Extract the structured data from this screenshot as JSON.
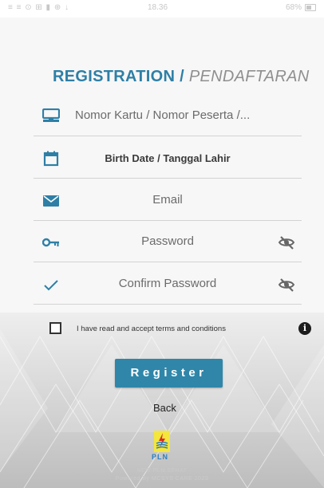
{
  "status_bar": {
    "left_icons": "≡ ≡ ⊙ ⊞ ▮ ⊕ ↓",
    "time": "18.36",
    "battery": "68%"
  },
  "title": {
    "main": "REGISTRATION",
    "slash": " / ",
    "sub": "PENDAFTARAN",
    "accent_color": "#2e7fa6"
  },
  "fields": {
    "card": {
      "placeholder": "Nomor Kartu / Nomor Peserta /...",
      "icon": "card-icon"
    },
    "birth_date": {
      "placeholder": "Birth Date / Tanggal Lahir",
      "icon": "calendar-icon"
    },
    "email": {
      "placeholder": "Email",
      "icon": "mail-icon"
    },
    "password": {
      "placeholder": "Password",
      "icon": "key-icon",
      "toggle_icon": "eye-off-icon"
    },
    "confirm_password": {
      "placeholder": "Confirm Password",
      "icon": "check-icon",
      "toggle_icon": "eye-off-icon"
    }
  },
  "terms": {
    "label": "I have read and accept terms and conditions",
    "checked": false,
    "info_icon": "info-icon",
    "info_glyph": "i"
  },
  "actions": {
    "register_label": "Register",
    "back_label": "Back",
    "button_color": "#2f86a9"
  },
  "brand": {
    "logo_text": "PLN",
    "footer_line1": "NEW PLN SEHAT",
    "footer_line2": "Powered By MCSYS CARE 2023"
  }
}
